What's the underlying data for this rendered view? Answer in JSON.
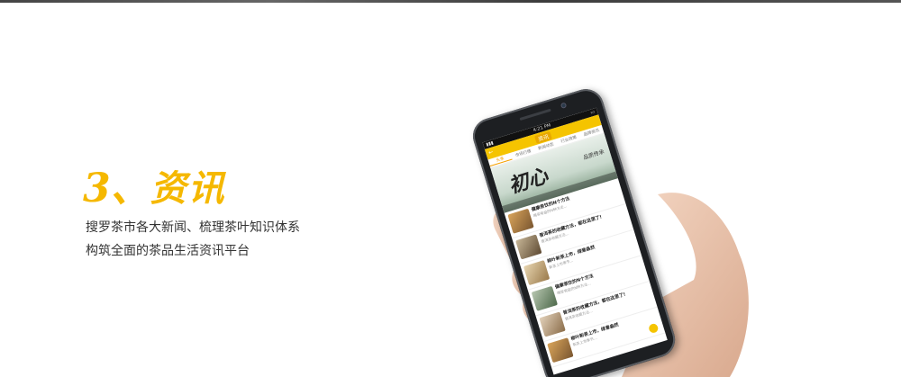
{
  "section": {
    "number": "3、",
    "heading": "资讯",
    "description_line1": "搜罗茶市各大新闻、梳理茶叶知识体系",
    "description_line2": "构筑全面的茶品生活资讯平台"
  },
  "phone": {
    "status_time": "4:21 PM",
    "app_title": "资讯",
    "tabs": [
      "头条",
      "市场行情",
      "新闻动态",
      "行业政策",
      "品牌资讯"
    ],
    "banner_text": "初心",
    "banner_sub": "品质传承",
    "articles": [
      {
        "title": "健康茶饮的N个方法",
        "sub": "喝茶有益的N种方法..."
      },
      {
        "title": "普洱茶的收藏方法，都在这里了!",
        "sub": "普洱茶收藏方法..."
      },
      {
        "title": "柳叶新茶上市，绿意盎然",
        "sub": "新茶上市季节..."
      },
      {
        "title": "健康茶饮的N个方法",
        "sub": "喝茶有益的N种方法..."
      },
      {
        "title": "普洱茶的收藏方法，都在这里了!",
        "sub": "普洱茶收藏方法..."
      },
      {
        "title": "柳叶新茶上市，绿意盎然",
        "sub": "新茶上市季节..."
      }
    ]
  },
  "colors": {
    "accent": "#f5b800",
    "text": "#333333"
  }
}
